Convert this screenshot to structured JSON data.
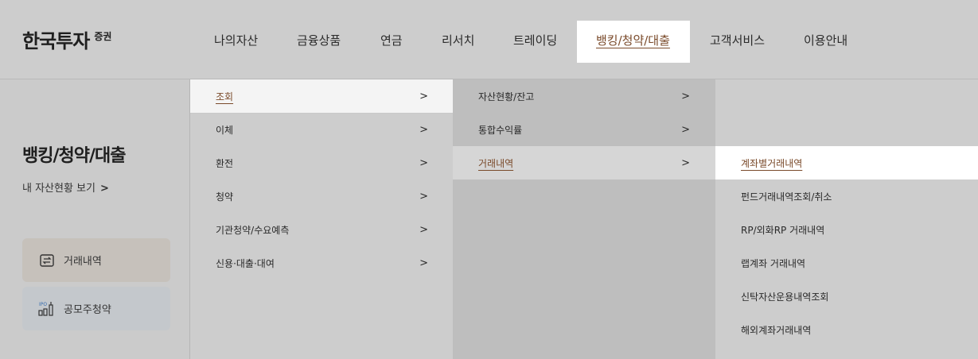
{
  "logo": {
    "name": "한국투자",
    "sub": "증권"
  },
  "gnb": [
    {
      "label": "나의자산"
    },
    {
      "label": "금융상품"
    },
    {
      "label": "연금"
    },
    {
      "label": "리서치"
    },
    {
      "label": "트레이딩"
    },
    {
      "label": "뱅킹/청약/대출"
    },
    {
      "label": "고객서비스"
    },
    {
      "label": "이용안내"
    }
  ],
  "left": {
    "title": "뱅킹/청약/대출",
    "link_label": "내 자산현황 보기",
    "link_chevron": ">",
    "quick": [
      {
        "label": "거래내역",
        "icon": "transfer-icon"
      },
      {
        "label": "공모주청약",
        "icon": "ipo-icon"
      }
    ]
  },
  "menu1": [
    {
      "label": "조회",
      "chevron": ">"
    },
    {
      "label": "이체",
      "chevron": ">"
    },
    {
      "label": "환전",
      "chevron": ">"
    },
    {
      "label": "청약",
      "chevron": ">"
    },
    {
      "label": "기관청약/수요예측",
      "chevron": ">"
    },
    {
      "label": "신용·대출·대여",
      "chevron": ">"
    }
  ],
  "menu2": [
    {
      "label": "자산현황/잔고",
      "chevron": ">"
    },
    {
      "label": "통합수익률",
      "chevron": ">"
    },
    {
      "label": "거래내역",
      "chevron": ">"
    }
  ],
  "menu3": [
    {
      "label": "계좌별거래내역"
    },
    {
      "label": "펀드거래내역조회/취소"
    },
    {
      "label": "RP/외화RP 거래내역"
    },
    {
      "label": "랩계좌 거래내역"
    },
    {
      "label": "신탁자산운용내역조회"
    },
    {
      "label": "해외계좌거래내역"
    }
  ],
  "colors": {
    "accent": "#7a4a2a",
    "quick1": "#c6c1bb",
    "quick2": "#c4c8cc"
  }
}
